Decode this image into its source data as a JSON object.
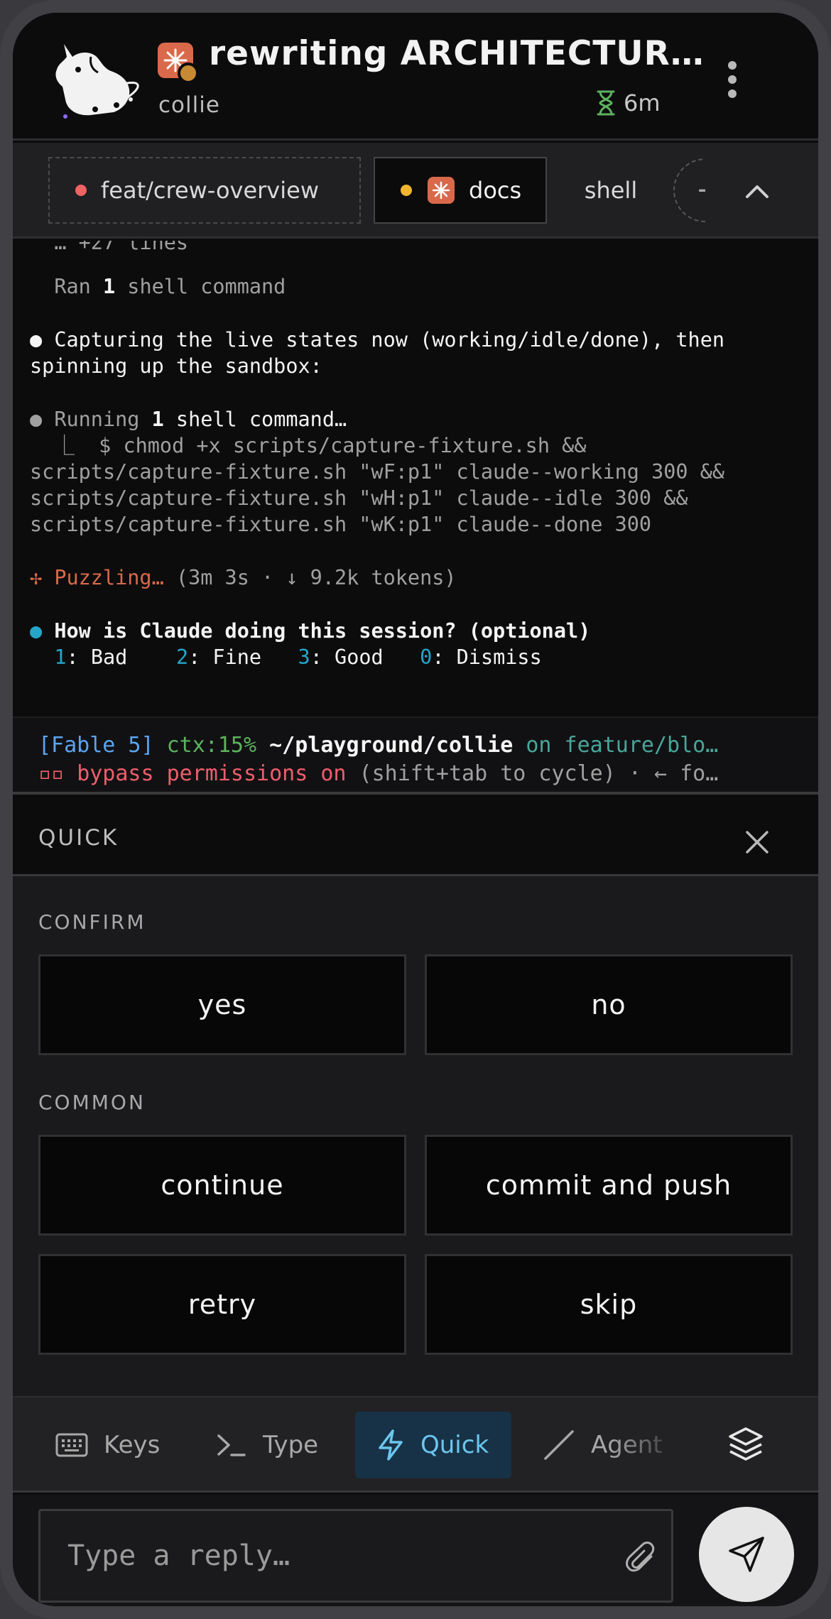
{
  "header": {
    "title": "rewriting ARCHITECTUR…",
    "subtitle": "collie",
    "elapsed": "6m"
  },
  "tabs": [
    {
      "label": "feat/crew-overview",
      "status_color": "#f06363"
    },
    {
      "label": "docs",
      "status_color": "#f2b531"
    },
    {
      "label": "shell"
    }
  ],
  "terminal": {
    "lines": {
      "truncated": "  … +27 lines",
      "ran_prefix": "  Ran ",
      "ran_count": "1",
      "ran_suffix": " shell command",
      "capture_1": "● Capturing the live states now (working/idle/done), then",
      "capture_2": "spinning up the sandbox:",
      "running_prefix": "● Running ",
      "running_count": "1",
      "running_suffix": " shell command…",
      "cmd_1": "  ⎿  $ chmod +x scripts/capture-fixture.sh &&",
      "cmd_2": "scripts/capture-fixture.sh \"wF:p1\" claude--working 300 &&",
      "cmd_3": "scripts/capture-fixture.sh \"wH:p1\" claude--idle 300 &&",
      "cmd_4": "scripts/capture-fixture.sh \"wK:p1\" claude--done 300",
      "puzzling_label": "✢ Puzzling…",
      "puzzling_stats": " (3m 3s · ↓ 9.2k tokens)",
      "question_bullet": "● ",
      "question": "How is Claude doing this session? (optional)",
      "rating_1_key": "1",
      "rating_1_label": ": Bad",
      "rating_2_key": "2",
      "rating_2_label": ": Fine",
      "rating_3_key": "3",
      "rating_3_label": ": Good",
      "rating_0_key": "0",
      "rating_0_label": ": Dismiss"
    },
    "status": {
      "model": "[Fable 5]",
      "ctx": "ctx:15%",
      "path": "~/playground/collie",
      "branch": "on feature/blo…",
      "perm_icon": "▫▫",
      "perm_text": "bypass permissions on",
      "perm_hint": " (shift+tab to cycle) · ← fo…"
    }
  },
  "quick": {
    "title": "QUICK",
    "sections": [
      {
        "label": "CONFIRM",
        "buttons": [
          "yes",
          "no"
        ]
      },
      {
        "label": "COMMON",
        "buttons": [
          "continue",
          "commit and push",
          "retry",
          "skip"
        ]
      }
    ]
  },
  "modes": [
    {
      "label": "Keys",
      "icon": "keyboard-icon"
    },
    {
      "label": "Type",
      "icon": "terminal-prompt-icon"
    },
    {
      "label": "Quick",
      "icon": "lightning-icon",
      "active": true
    },
    {
      "label": "Agent",
      "icon": "slash-icon"
    }
  ],
  "composer": {
    "placeholder": "Type a reply…"
  },
  "colors": {
    "accent": "#6cc6ee",
    "active_mode_bg": "#173246",
    "brand_orange": "#d9694a",
    "elapsed_green": "#5db25f"
  }
}
